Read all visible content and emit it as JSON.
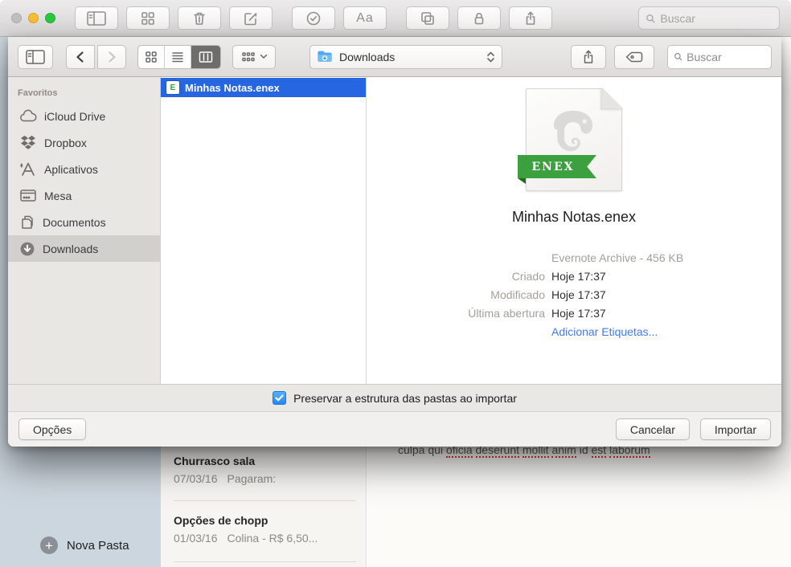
{
  "window": {
    "toolbar": {
      "format_label": "Aa",
      "search_placeholder": "Buscar"
    }
  },
  "dialog": {
    "toolbar": {
      "location": "Downloads",
      "search_placeholder": "Buscar"
    },
    "sidebar": {
      "header": "Favoritos",
      "items": [
        {
          "label": "iCloud Drive"
        },
        {
          "label": "Dropbox"
        },
        {
          "label": "Aplicativos"
        },
        {
          "label": "Mesa"
        },
        {
          "label": "Documentos"
        },
        {
          "label": "Downloads",
          "selected": true
        }
      ]
    },
    "files": [
      {
        "name": "Minhas Notas.enex",
        "selected": true
      }
    ],
    "preview": {
      "file_name": "Minhas Notas.enex",
      "badge": "ENEX",
      "kind": "Evernote Archive - 456 KB",
      "details": [
        {
          "label": "Criado",
          "value": "Hoje 17:37"
        },
        {
          "label": "Modificado",
          "value": "Hoje 17:37"
        },
        {
          "label": "Última abertura",
          "value": "Hoje 17:37"
        }
      ],
      "tags_link": "Adicionar Etiquetas..."
    },
    "import_option": {
      "label": "Preservar a estrutura das pastas ao importar",
      "checked": true
    },
    "actions": {
      "options": "Opções",
      "cancel": "Cancelar",
      "import": "Importar"
    }
  },
  "background": {
    "notes": [
      {
        "title": "Churrasco sala",
        "date": "07/03/16",
        "snippet": "Pagaram:"
      },
      {
        "title": "Opções de chopp",
        "date": "01/03/16",
        "snippet": "Colina - R$ 6,50..."
      }
    ],
    "note_line": [
      "culpa qui ",
      "oficia",
      " ",
      "deserunt",
      " ",
      "mollit",
      " ",
      "anim",
      " id ",
      "est",
      " ",
      "laborum"
    ],
    "new_folder": "Nova Pasta"
  },
  "colors": {
    "selection_blue": "#2666e0",
    "checkbox_blue": "#2388f5",
    "link_blue": "#3e7cf0",
    "enex_green": "#3da03f",
    "folder_blue": "#51a8ec"
  }
}
